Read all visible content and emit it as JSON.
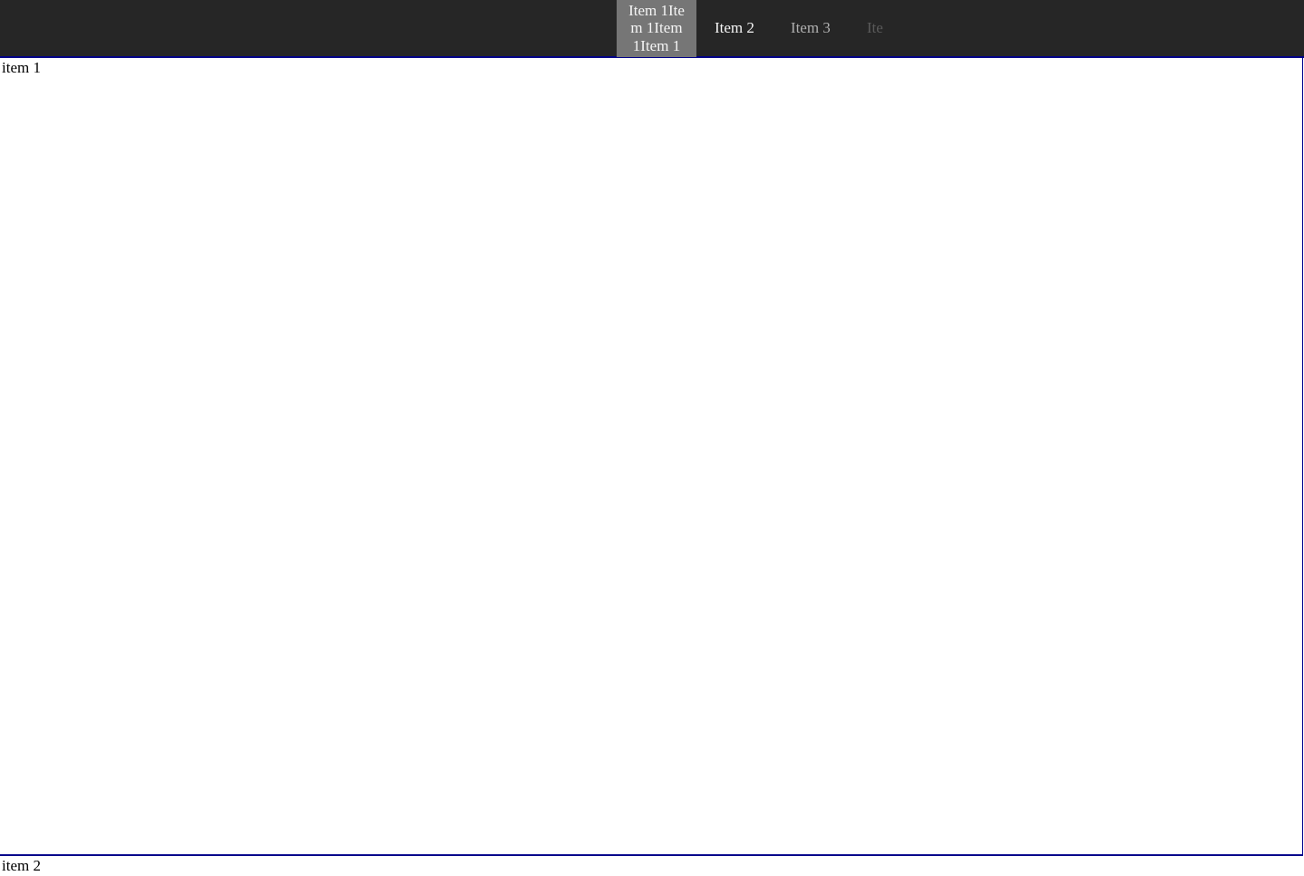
{
  "nav": {
    "items": [
      {
        "label": "Item 1Item 1Item 1Item 1",
        "active": true
      },
      {
        "label": "Item 2",
        "active": false
      },
      {
        "label": "Item 3",
        "active": false
      },
      {
        "label": "Ite",
        "active": false
      }
    ]
  },
  "sections": [
    {
      "label": "item 1"
    },
    {
      "label": "item 2"
    }
  ]
}
